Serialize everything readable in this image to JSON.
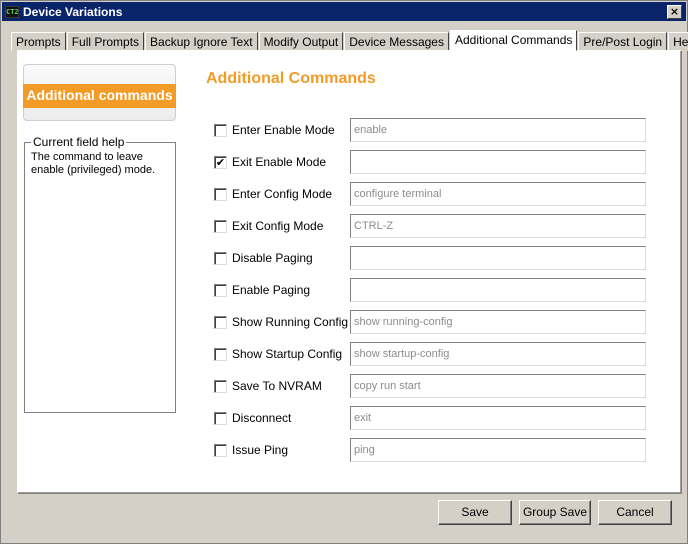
{
  "window": {
    "title": "Device Variations",
    "app_icon": "CT2",
    "close_glyph": "×"
  },
  "tabs": [
    {
      "label": "Prompts",
      "active": false
    },
    {
      "label": "Full Prompts",
      "active": false
    },
    {
      "label": "Backup Ignore Text",
      "active": false
    },
    {
      "label": "Modify Output",
      "active": false
    },
    {
      "label": "Device Messages",
      "active": false
    },
    {
      "label": "Additional Commands",
      "active": true
    },
    {
      "label": "Pre/Post Login",
      "active": false
    },
    {
      "label": "Help",
      "active": false
    }
  ],
  "badge": {
    "label": "Additional commands"
  },
  "help": {
    "legend": "Current field help",
    "text": "The command to leave enable (privileged) mode."
  },
  "heading": "Additional Commands",
  "commands": [
    {
      "label": "Enter Enable Mode",
      "checked": false,
      "value": "",
      "placeholder": "enable"
    },
    {
      "label": "Exit Enable Mode",
      "checked": true,
      "value": "",
      "placeholder": ""
    },
    {
      "label": "Enter Config Mode",
      "checked": false,
      "value": "",
      "placeholder": "configure terminal"
    },
    {
      "label": "Exit Config Mode",
      "checked": false,
      "value": "",
      "placeholder": "CTRL-Z"
    },
    {
      "label": "Disable Paging",
      "checked": false,
      "value": "",
      "placeholder": ""
    },
    {
      "label": "Enable Paging",
      "checked": false,
      "value": "",
      "placeholder": ""
    },
    {
      "label": "Show Running Config",
      "checked": false,
      "value": "",
      "placeholder": "show running-config"
    },
    {
      "label": "Show Startup Config",
      "checked": false,
      "value": "",
      "placeholder": "show startup-config"
    },
    {
      "label": "Save To NVRAM",
      "checked": false,
      "value": "",
      "placeholder": "copy run start"
    },
    {
      "label": "Disconnect",
      "checked": false,
      "value": "",
      "placeholder": "exit"
    },
    {
      "label": "Issue Ping",
      "checked": false,
      "value": "",
      "placeholder": "ping"
    }
  ],
  "buttons": {
    "save": "Save",
    "group_save": "Group Save",
    "cancel": "Cancel"
  },
  "colors": {
    "accent_orange": "#f39b27",
    "titlebar_blue": "#0a246a"
  }
}
